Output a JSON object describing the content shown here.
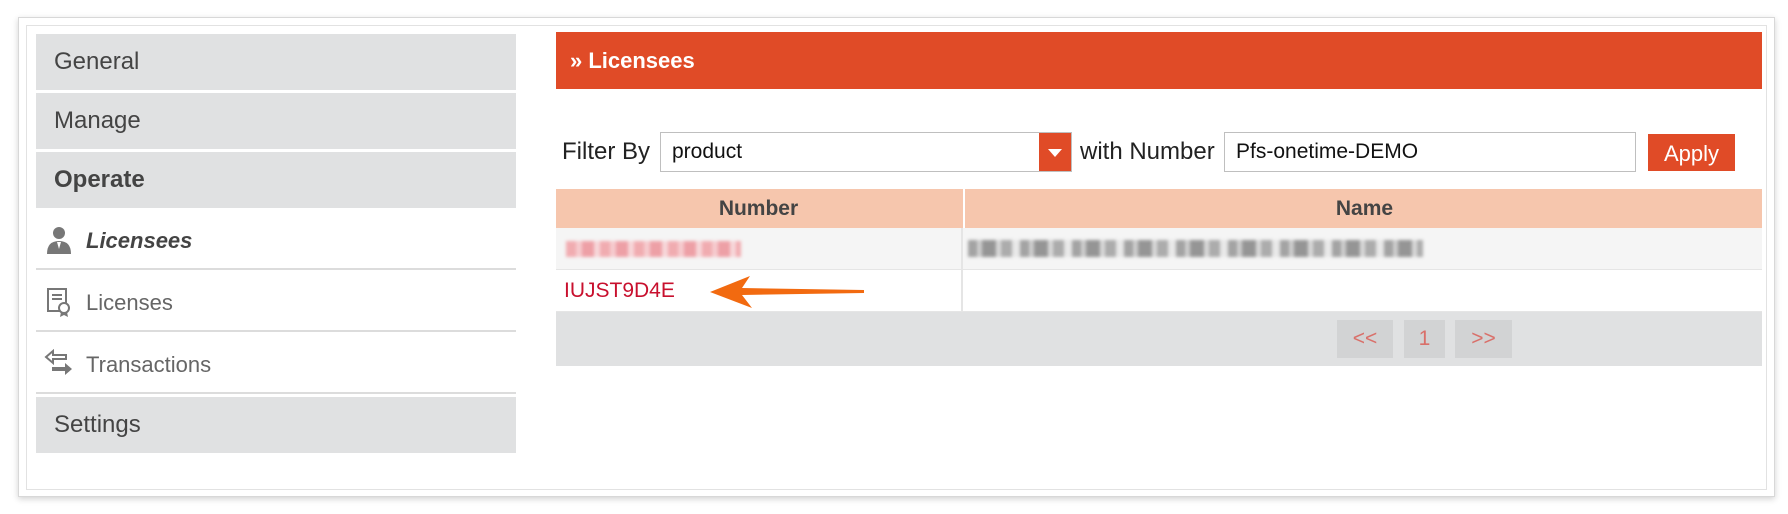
{
  "sidebar": {
    "sections": [
      "General",
      "Manage",
      "Operate"
    ],
    "items": [
      {
        "label": "Licensees",
        "icon": "user-icon"
      },
      {
        "label": "Licenses",
        "icon": "certificate-icon"
      },
      {
        "label": "Transactions",
        "icon": "transfer-icon"
      }
    ],
    "settings": "Settings"
  },
  "header": {
    "title": "» Licensees"
  },
  "filter": {
    "label": "Filter By",
    "selected": "product",
    "with_label": "with Number",
    "number_value": "Pfs-onetime-DEMO",
    "apply_label": "Apply"
  },
  "table": {
    "columns": [
      "Number",
      "Name"
    ],
    "rows": [
      {
        "number": "",
        "name": ""
      },
      {
        "number": "IUJST9D4E",
        "name": ""
      }
    ]
  },
  "pager": {
    "prev": "<<",
    "page": "1",
    "next": ">>"
  },
  "colors": {
    "accent": "#e04b27",
    "table_header": "#f6c6ad",
    "link_red": "#c8102e",
    "arrow": "#f26a10"
  }
}
